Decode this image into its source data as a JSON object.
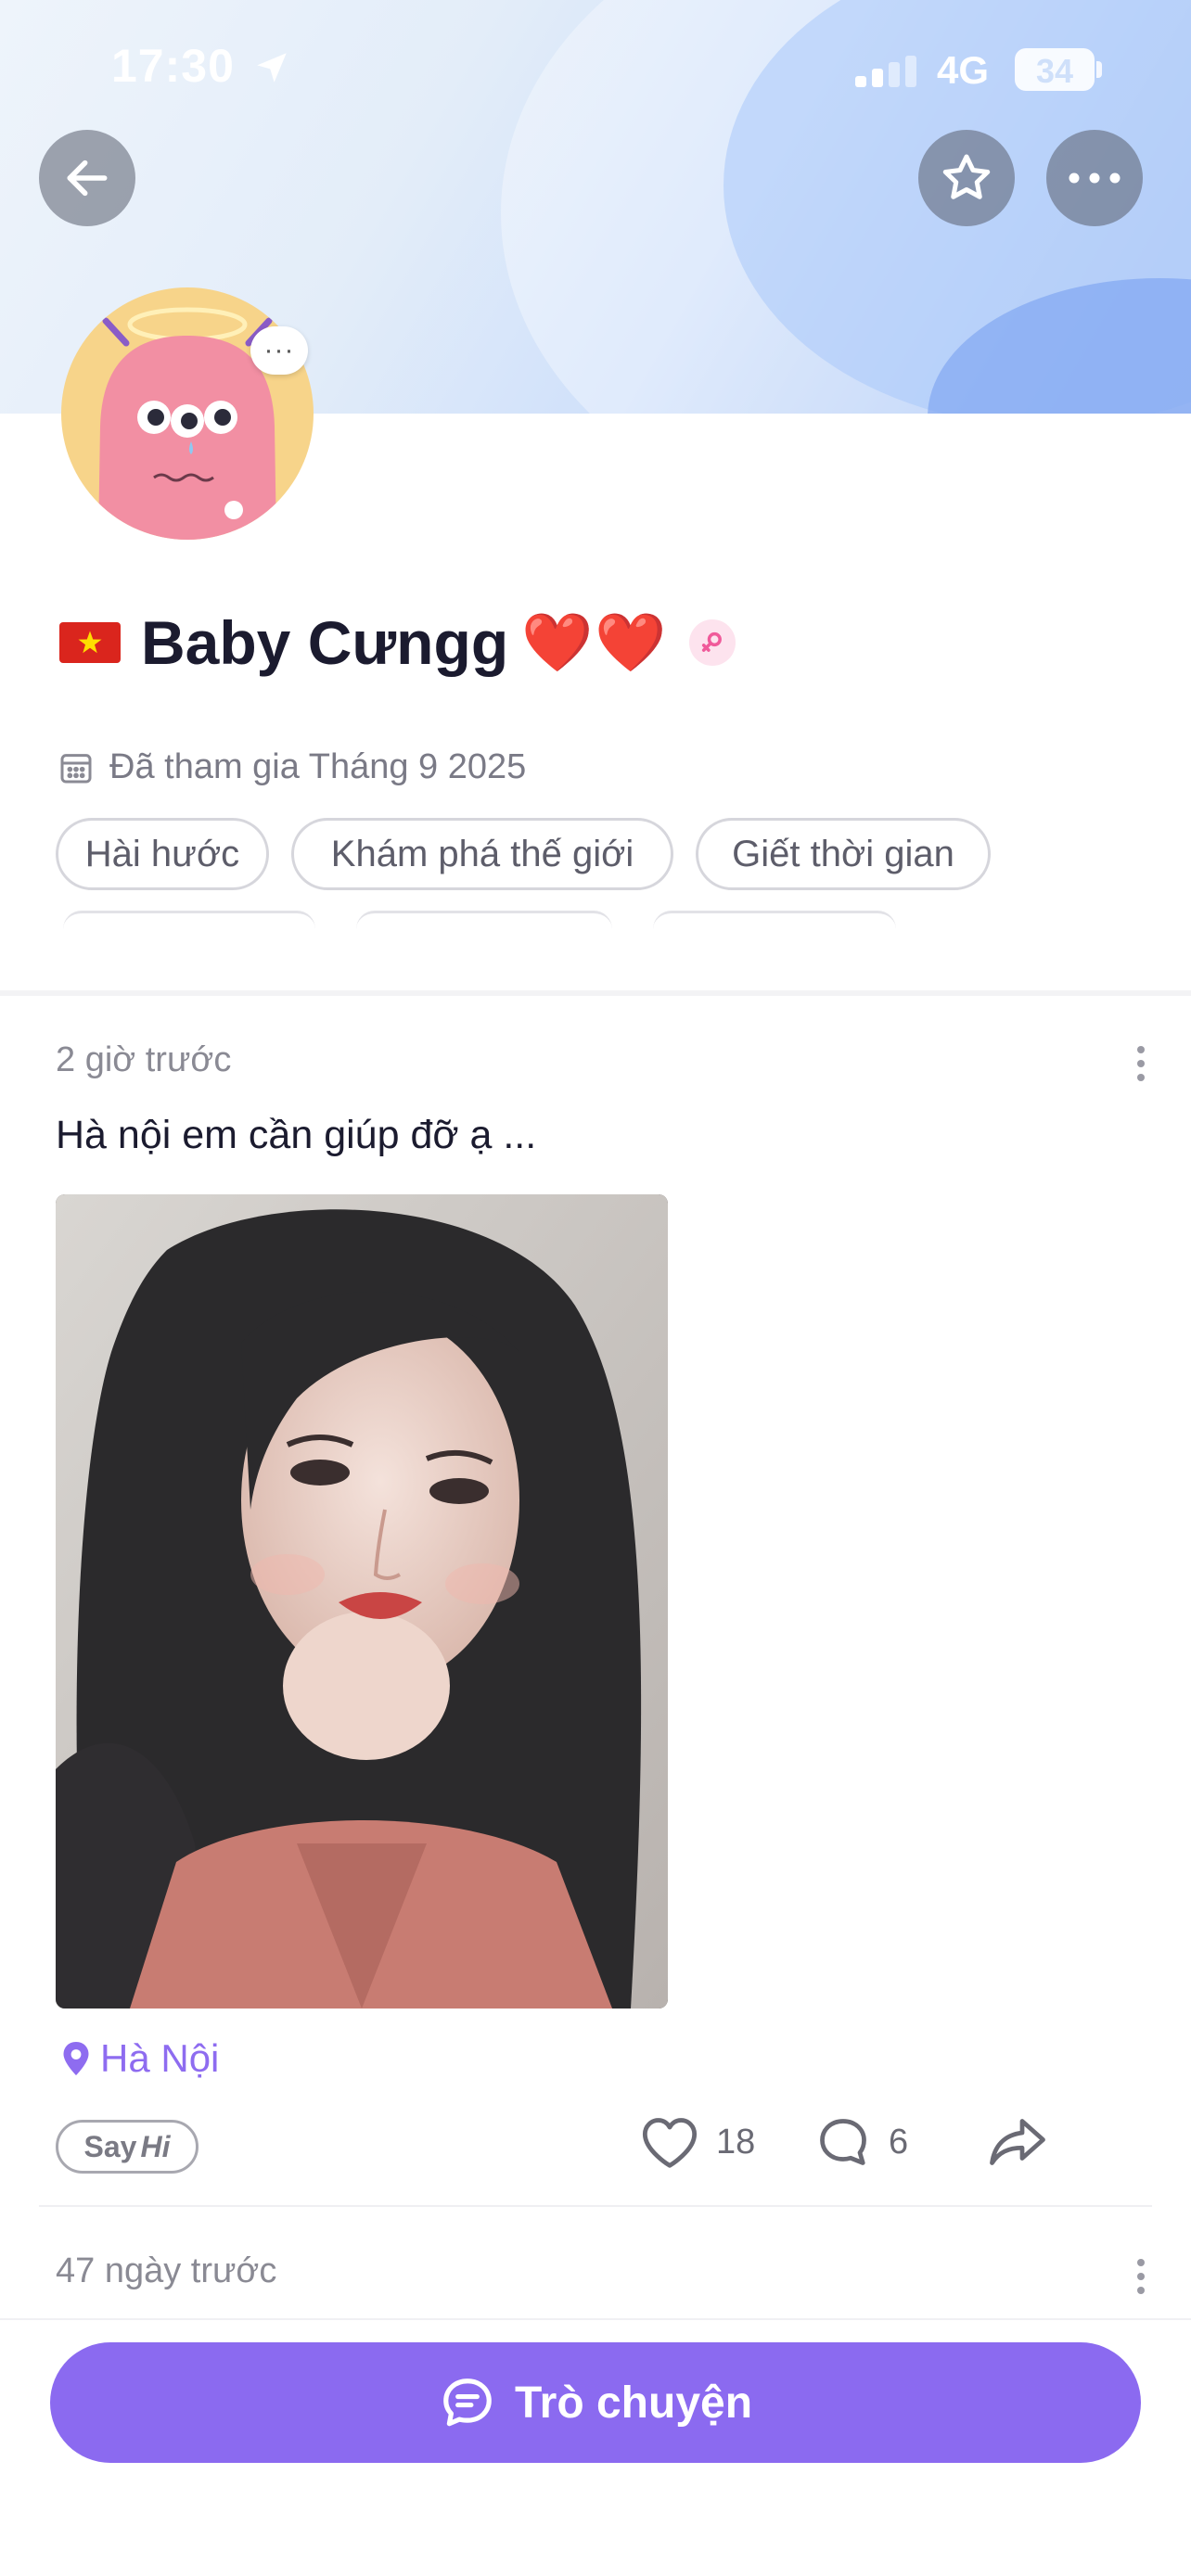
{
  "status_bar": {
    "time": "17:30",
    "network": "4G",
    "battery": "34"
  },
  "header": {
    "back_icon": "arrow-left-icon",
    "favorite_icon": "star-icon",
    "more_icon": "more-horizontal-icon"
  },
  "profile": {
    "flag": "vietnam-flag",
    "name": "Baby Cưngg",
    "name_suffix": "❤️❤️",
    "gender_icon": "female-icon",
    "joined": "Đã tham gia Tháng 9 2025",
    "tags": [
      "Hài hước",
      "Khám phá thế giới",
      "Giết thời gian"
    ]
  },
  "post": {
    "time": "2 giờ trước",
    "text": "Hà nội em cần giúp đỡ ạ ...",
    "location": "Hà Nội",
    "say_hi_prefix": "Say",
    "say_hi_suffix": "Hi",
    "likes": "18",
    "comments": "6"
  },
  "post2": {
    "time": "47 ngày trước"
  },
  "bottom": {
    "chat_label": "Trò chuyện"
  },
  "colors": {
    "accent": "#8b6af0",
    "heart": "#e0262e",
    "location": "#8e6cf0"
  }
}
